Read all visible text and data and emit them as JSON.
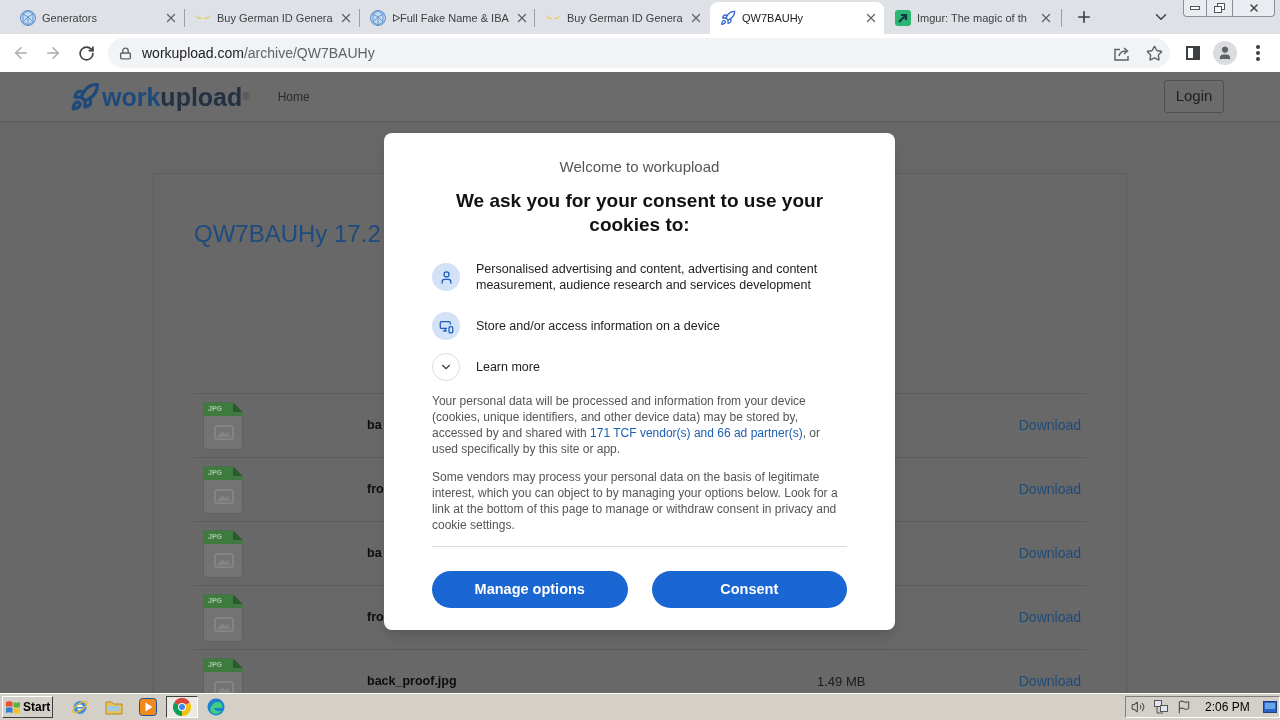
{
  "browser": {
    "tabs": [
      {
        "title": "Generators",
        "selected": false
      },
      {
        "title": "Buy German ID Genera",
        "selected": false
      },
      {
        "title": "ᐅFull Fake Name & IBA",
        "selected": false
      },
      {
        "title": "Buy German ID Genera",
        "selected": false
      },
      {
        "title": "QW7BAUHy",
        "selected": true
      },
      {
        "title": "Imgur: The magic of th",
        "selected": false
      }
    ],
    "address_bar": {
      "host": "workupload.com",
      "path": "/archive/QW7BAUHy"
    }
  },
  "page": {
    "header": {
      "logo": {
        "parts": [
          "work",
          "upload"
        ],
        "mark": "®"
      },
      "nav": [
        "Home"
      ],
      "login": "Login"
    },
    "archive": {
      "title": "QW7BAUHy 17.2",
      "files": [
        {
          "type": "JPG",
          "name": "ba",
          "download": "Download"
        },
        {
          "type": "JPG",
          "name": "fro",
          "download": "Download"
        },
        {
          "type": "JPG",
          "name": "ba",
          "download": "Download"
        },
        {
          "type": "JPG",
          "name": "fro",
          "download": "Download"
        },
        {
          "type": "JPG",
          "name": "back_proof.jpg",
          "size": "1.49 MB",
          "download": "Download"
        }
      ]
    }
  },
  "consent_dialog": {
    "welcome": "Welcome to workupload",
    "heading": "We ask you for your consent to use your cookies to:",
    "purposes": [
      {
        "text": "Personalised advertising and content, advertising and content measurement, audience research and services development"
      },
      {
        "text": "Store and/or access information on a device"
      }
    ],
    "learn_more": {
      "label": "Learn more",
      "expanded": false
    },
    "paragraphs": [
      {
        "text": "Your personal data will be processed and information from your device (cookies, unique identifiers, and other device data) may be stored by, accessed by and shared with ",
        "link": "171 TCF vendor(s) and 66 ad partner(s)",
        "after": ", or used specifically by this site or app."
      },
      {
        "text": "Some vendors may process your personal data on the basis of legitimate interest, which you can object to by managing your options below. Look for a link at the bottom of this page to manage or withdraw consent in privacy and cookie settings."
      }
    ],
    "buttons": [
      {
        "label": "Manage options"
      },
      {
        "label": "Consent"
      }
    ]
  },
  "taskbar": {
    "start": "Start",
    "apps": [
      {
        "selected": false
      },
      {
        "selected": false
      },
      {
        "selected": false
      },
      {
        "selected": true
      },
      {
        "selected": false
      }
    ],
    "clock": "2:06 PM"
  }
}
